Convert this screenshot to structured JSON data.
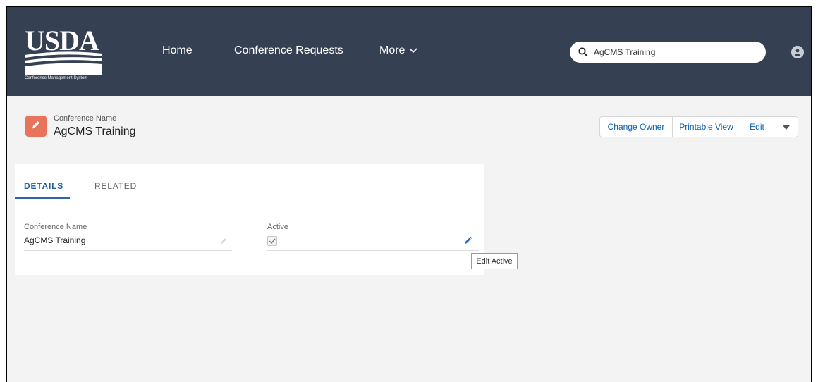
{
  "header": {
    "logo": {
      "text": "USDA",
      "subtitle": "Conference Management System"
    },
    "nav": [
      {
        "label": "Home"
      },
      {
        "label": "Conference Requests"
      },
      {
        "label": "More"
      }
    ],
    "search": {
      "value": "AgCMS Training"
    }
  },
  "record": {
    "type_label": "Conference Name",
    "title": "AgCMS Training",
    "actions": {
      "change_owner": "Change Owner",
      "printable_view": "Printable View",
      "edit": "Edit"
    }
  },
  "panel": {
    "tabs": [
      {
        "label": "DETAILS",
        "active": true
      },
      {
        "label": "RELATED",
        "active": false
      }
    ],
    "fields": {
      "conference_name": {
        "label": "Conference Name",
        "value": "AgCMS Training"
      },
      "active": {
        "label": "Active",
        "checked": true
      }
    }
  },
  "tooltip": {
    "text": "Edit Active"
  },
  "colors": {
    "header_bg": "#354052",
    "record_icon": "#e8755b",
    "link_blue": "#0a62b0",
    "tab_active": "#1f5f9a"
  },
  "icons": [
    "chevron-down-icon",
    "search-icon",
    "user-avatar-icon",
    "pencil-icon",
    "checkmark-icon",
    "caret-down-icon"
  ]
}
